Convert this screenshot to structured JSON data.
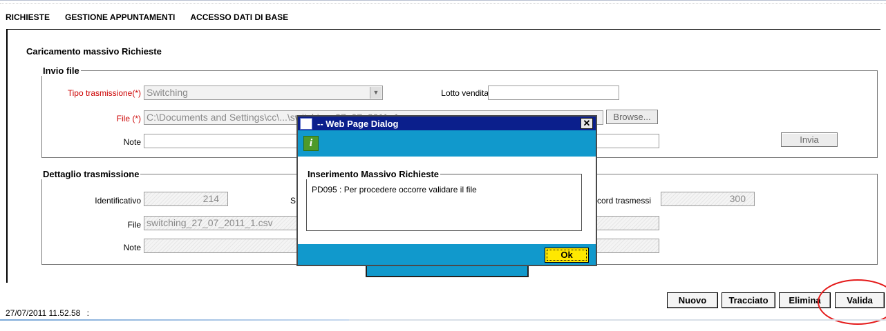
{
  "menu": {
    "items": [
      "RICHIESTE",
      "GESTIONE APPUNTAMENTI",
      "ACCESSO DATI DI BASE"
    ]
  },
  "main": {
    "legend": "Caricamento massivo Richieste",
    "invio": {
      "legend": "Invio file",
      "tipo_label": "Tipo trasmissione(*)",
      "tipo_value": "Switching",
      "lotto_label": "Lotto vendita",
      "lotto_value": "",
      "file_label": "File (*)",
      "file_value": "C:\\Documents and Settings\\cc\\...\\switching_27_07_2011_1.csv",
      "browse_label": "Browse...",
      "note_label": "Note",
      "note_value": "",
      "invia_label": "Invia"
    },
    "dettaglio": {
      "legend": "Dettaglio trasmissione",
      "identificativo_label": "Identificativo",
      "identificativo_value": "214",
      "s_label_fragment": "S",
      "record_label_fragment": "cord trasmessi",
      "record_value": "300",
      "file_label": "File",
      "file_value": "switching_27_07_2011_1.csv",
      "note_label": "Note"
    }
  },
  "dialog": {
    "title": "-- Web Page Dialog",
    "group_legend": "Inserimento Massivo Richieste",
    "message": "PD095 : Per procedere occorre validare il file",
    "ok_label": "Ok",
    "colors": {
      "title_bar": "#0b1f8c",
      "band": "#1199cc",
      "ok": "#ffe800"
    }
  },
  "actions": {
    "nuovo": "Nuovo",
    "tracciato": "Tracciato",
    "elimina": "Elimina",
    "valida": "Valida"
  },
  "status": {
    "timestamp": "27/07/2011 11.52.58",
    "sep": ":"
  },
  "colors": {
    "required_label": "#cc0000",
    "highlight_circle": "#e41a1a"
  }
}
